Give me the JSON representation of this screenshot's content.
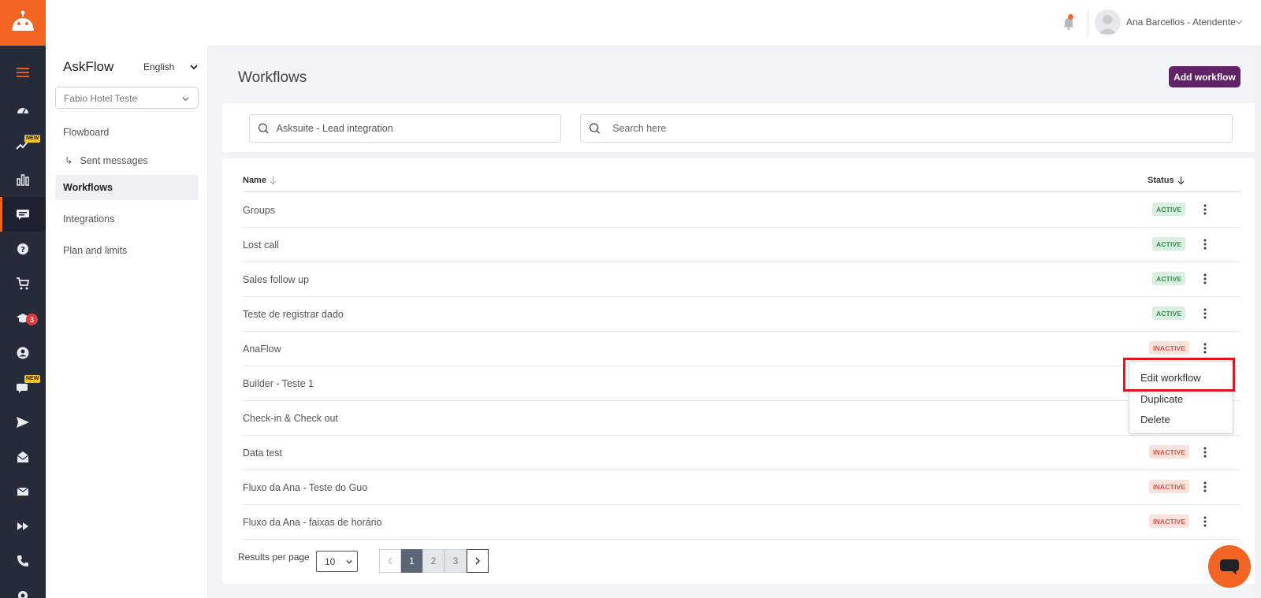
{
  "header": {
    "user_name": "Ana Barcellos - Atendente"
  },
  "rail": {
    "new_badge": "NEW",
    "notification_count": "3"
  },
  "sidebar": {
    "app_title": "AskFlow",
    "language": "English",
    "hotel": "Fabio Hotel Teste",
    "items": [
      {
        "label": "Flowboard"
      },
      {
        "label": "Sent messages",
        "arrow": "↳"
      },
      {
        "label": "Workflows"
      },
      {
        "label": "Integrations"
      },
      {
        "label": "Plan and limits"
      }
    ]
  },
  "main": {
    "title": "Workflows",
    "add_button": "Add workflow",
    "filter_value": "Asksuite - Lead integration",
    "search_placeholder": "Search here",
    "columns": {
      "name": "Name",
      "status": "Status"
    },
    "rows": [
      {
        "name": "Groups",
        "status": "ACTIVE"
      },
      {
        "name": "Lost call",
        "status": "ACTIVE"
      },
      {
        "name": "Sales follow up",
        "status": "ACTIVE"
      },
      {
        "name": "Teste de registrar dado",
        "status": "ACTIVE"
      },
      {
        "name": "AnaFlow",
        "status": "INACTIVE"
      },
      {
        "name": "Builder - Teste 1",
        "status": ""
      },
      {
        "name": "Check-in & Check out",
        "status": ""
      },
      {
        "name": "Data test",
        "status": "INACTIVE"
      },
      {
        "name": "Fluxo da Ana - Teste do Guo",
        "status": "INACTIVE"
      },
      {
        "name": "Fluxo da Ana - faixas de horário",
        "status": "INACTIVE"
      }
    ],
    "row_menu": [
      "Edit workflow",
      "Duplicate",
      "Delete"
    ]
  },
  "pagination": {
    "results_label": "Results per page",
    "per_page": "10",
    "pages": [
      "1",
      "2",
      "3"
    ],
    "current_page": "1"
  },
  "colors": {
    "brand_orange": "#f26522",
    "rail_bg": "#262b3a",
    "primary_button": "#5f2366",
    "highlight_border": "#e3141b"
  }
}
